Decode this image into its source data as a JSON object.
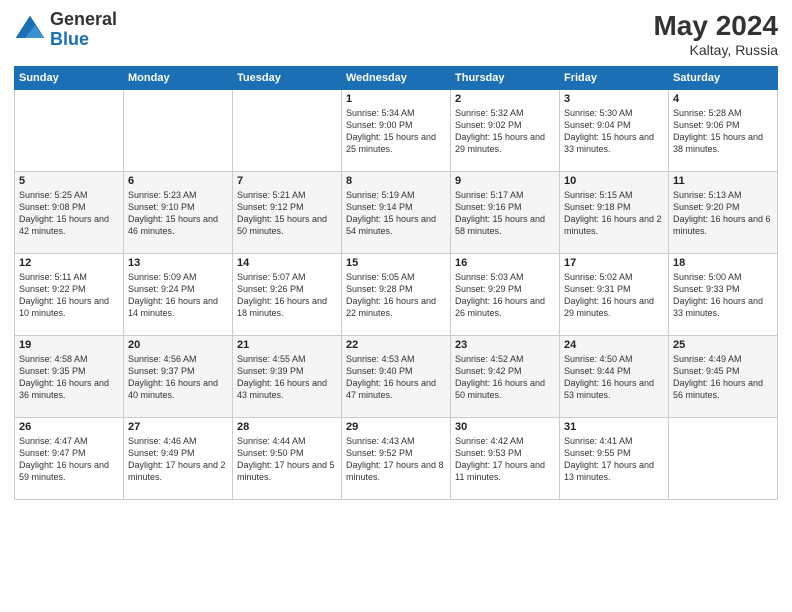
{
  "header": {
    "logo_general": "General",
    "logo_blue": "Blue",
    "title": "May 2024",
    "location": "Kaltay, Russia"
  },
  "days_of_week": [
    "Sunday",
    "Monday",
    "Tuesday",
    "Wednesday",
    "Thursday",
    "Friday",
    "Saturday"
  ],
  "weeks": [
    [
      {
        "day": "",
        "info": ""
      },
      {
        "day": "",
        "info": ""
      },
      {
        "day": "",
        "info": ""
      },
      {
        "day": "1",
        "info": "Sunrise: 5:34 AM\nSunset: 9:00 PM\nDaylight: 15 hours and 25 minutes."
      },
      {
        "day": "2",
        "info": "Sunrise: 5:32 AM\nSunset: 9:02 PM\nDaylight: 15 hours and 29 minutes."
      },
      {
        "day": "3",
        "info": "Sunrise: 5:30 AM\nSunset: 9:04 PM\nDaylight: 15 hours and 33 minutes."
      },
      {
        "day": "4",
        "info": "Sunrise: 5:28 AM\nSunset: 9:06 PM\nDaylight: 15 hours and 38 minutes."
      }
    ],
    [
      {
        "day": "5",
        "info": "Sunrise: 5:25 AM\nSunset: 9:08 PM\nDaylight: 15 hours and 42 minutes."
      },
      {
        "day": "6",
        "info": "Sunrise: 5:23 AM\nSunset: 9:10 PM\nDaylight: 15 hours and 46 minutes."
      },
      {
        "day": "7",
        "info": "Sunrise: 5:21 AM\nSunset: 9:12 PM\nDaylight: 15 hours and 50 minutes."
      },
      {
        "day": "8",
        "info": "Sunrise: 5:19 AM\nSunset: 9:14 PM\nDaylight: 15 hours and 54 minutes."
      },
      {
        "day": "9",
        "info": "Sunrise: 5:17 AM\nSunset: 9:16 PM\nDaylight: 15 hours and 58 minutes."
      },
      {
        "day": "10",
        "info": "Sunrise: 5:15 AM\nSunset: 9:18 PM\nDaylight: 16 hours and 2 minutes."
      },
      {
        "day": "11",
        "info": "Sunrise: 5:13 AM\nSunset: 9:20 PM\nDaylight: 16 hours and 6 minutes."
      }
    ],
    [
      {
        "day": "12",
        "info": "Sunrise: 5:11 AM\nSunset: 9:22 PM\nDaylight: 16 hours and 10 minutes."
      },
      {
        "day": "13",
        "info": "Sunrise: 5:09 AM\nSunset: 9:24 PM\nDaylight: 16 hours and 14 minutes."
      },
      {
        "day": "14",
        "info": "Sunrise: 5:07 AM\nSunset: 9:26 PM\nDaylight: 16 hours and 18 minutes."
      },
      {
        "day": "15",
        "info": "Sunrise: 5:05 AM\nSunset: 9:28 PM\nDaylight: 16 hours and 22 minutes."
      },
      {
        "day": "16",
        "info": "Sunrise: 5:03 AM\nSunset: 9:29 PM\nDaylight: 16 hours and 26 minutes."
      },
      {
        "day": "17",
        "info": "Sunrise: 5:02 AM\nSunset: 9:31 PM\nDaylight: 16 hours and 29 minutes."
      },
      {
        "day": "18",
        "info": "Sunrise: 5:00 AM\nSunset: 9:33 PM\nDaylight: 16 hours and 33 minutes."
      }
    ],
    [
      {
        "day": "19",
        "info": "Sunrise: 4:58 AM\nSunset: 9:35 PM\nDaylight: 16 hours and 36 minutes."
      },
      {
        "day": "20",
        "info": "Sunrise: 4:56 AM\nSunset: 9:37 PM\nDaylight: 16 hours and 40 minutes."
      },
      {
        "day": "21",
        "info": "Sunrise: 4:55 AM\nSunset: 9:39 PM\nDaylight: 16 hours and 43 minutes."
      },
      {
        "day": "22",
        "info": "Sunrise: 4:53 AM\nSunset: 9:40 PM\nDaylight: 16 hours and 47 minutes."
      },
      {
        "day": "23",
        "info": "Sunrise: 4:52 AM\nSunset: 9:42 PM\nDaylight: 16 hours and 50 minutes."
      },
      {
        "day": "24",
        "info": "Sunrise: 4:50 AM\nSunset: 9:44 PM\nDaylight: 16 hours and 53 minutes."
      },
      {
        "day": "25",
        "info": "Sunrise: 4:49 AM\nSunset: 9:45 PM\nDaylight: 16 hours and 56 minutes."
      }
    ],
    [
      {
        "day": "26",
        "info": "Sunrise: 4:47 AM\nSunset: 9:47 PM\nDaylight: 16 hours and 59 minutes."
      },
      {
        "day": "27",
        "info": "Sunrise: 4:46 AM\nSunset: 9:49 PM\nDaylight: 17 hours and 2 minutes."
      },
      {
        "day": "28",
        "info": "Sunrise: 4:44 AM\nSunset: 9:50 PM\nDaylight: 17 hours and 5 minutes."
      },
      {
        "day": "29",
        "info": "Sunrise: 4:43 AM\nSunset: 9:52 PM\nDaylight: 17 hours and 8 minutes."
      },
      {
        "day": "30",
        "info": "Sunrise: 4:42 AM\nSunset: 9:53 PM\nDaylight: 17 hours and 11 minutes."
      },
      {
        "day": "31",
        "info": "Sunrise: 4:41 AM\nSunset: 9:55 PM\nDaylight: 17 hours and 13 minutes."
      },
      {
        "day": "",
        "info": ""
      }
    ]
  ]
}
